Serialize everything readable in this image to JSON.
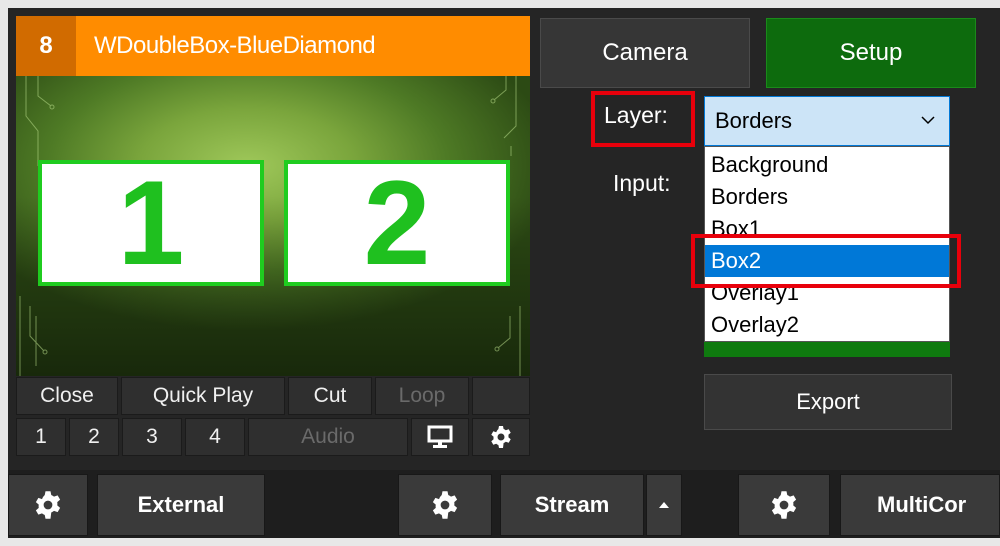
{
  "input_panel": {
    "number": "8",
    "title": "WDoubleBox-BlueDiamond",
    "preview": {
      "box1_label": "1",
      "box2_label": "2"
    },
    "controls_row1": [
      "Close",
      "Quick Play",
      "Cut",
      "Loop"
    ],
    "controls_row2": [
      "1",
      "2",
      "3",
      "4",
      "Audio"
    ],
    "icons": [
      "monitor-icon",
      "gear-icon"
    ]
  },
  "setup_panel": {
    "camera_label": "Camera",
    "setup_label": "Setup",
    "layer_label": "Layer:",
    "input_label": "Input:",
    "layer_selected": "Borders",
    "layer_options": [
      "Background",
      "Borders",
      "Box1",
      "Box2",
      "Overlay1",
      "Overlay2"
    ],
    "highlighted_option": "Box2",
    "export_label": "Export"
  },
  "bottom_bar": {
    "external_label": "External",
    "stream_label": "Stream",
    "multicorder_label": "MultiCor"
  },
  "colors": {
    "title_orange": "#ff8c00",
    "setup_green": "#0d6b0d",
    "selection_blue": "#0078d7",
    "highlight_red": "#e8000b",
    "box_border_green": "#1fcc1f"
  }
}
